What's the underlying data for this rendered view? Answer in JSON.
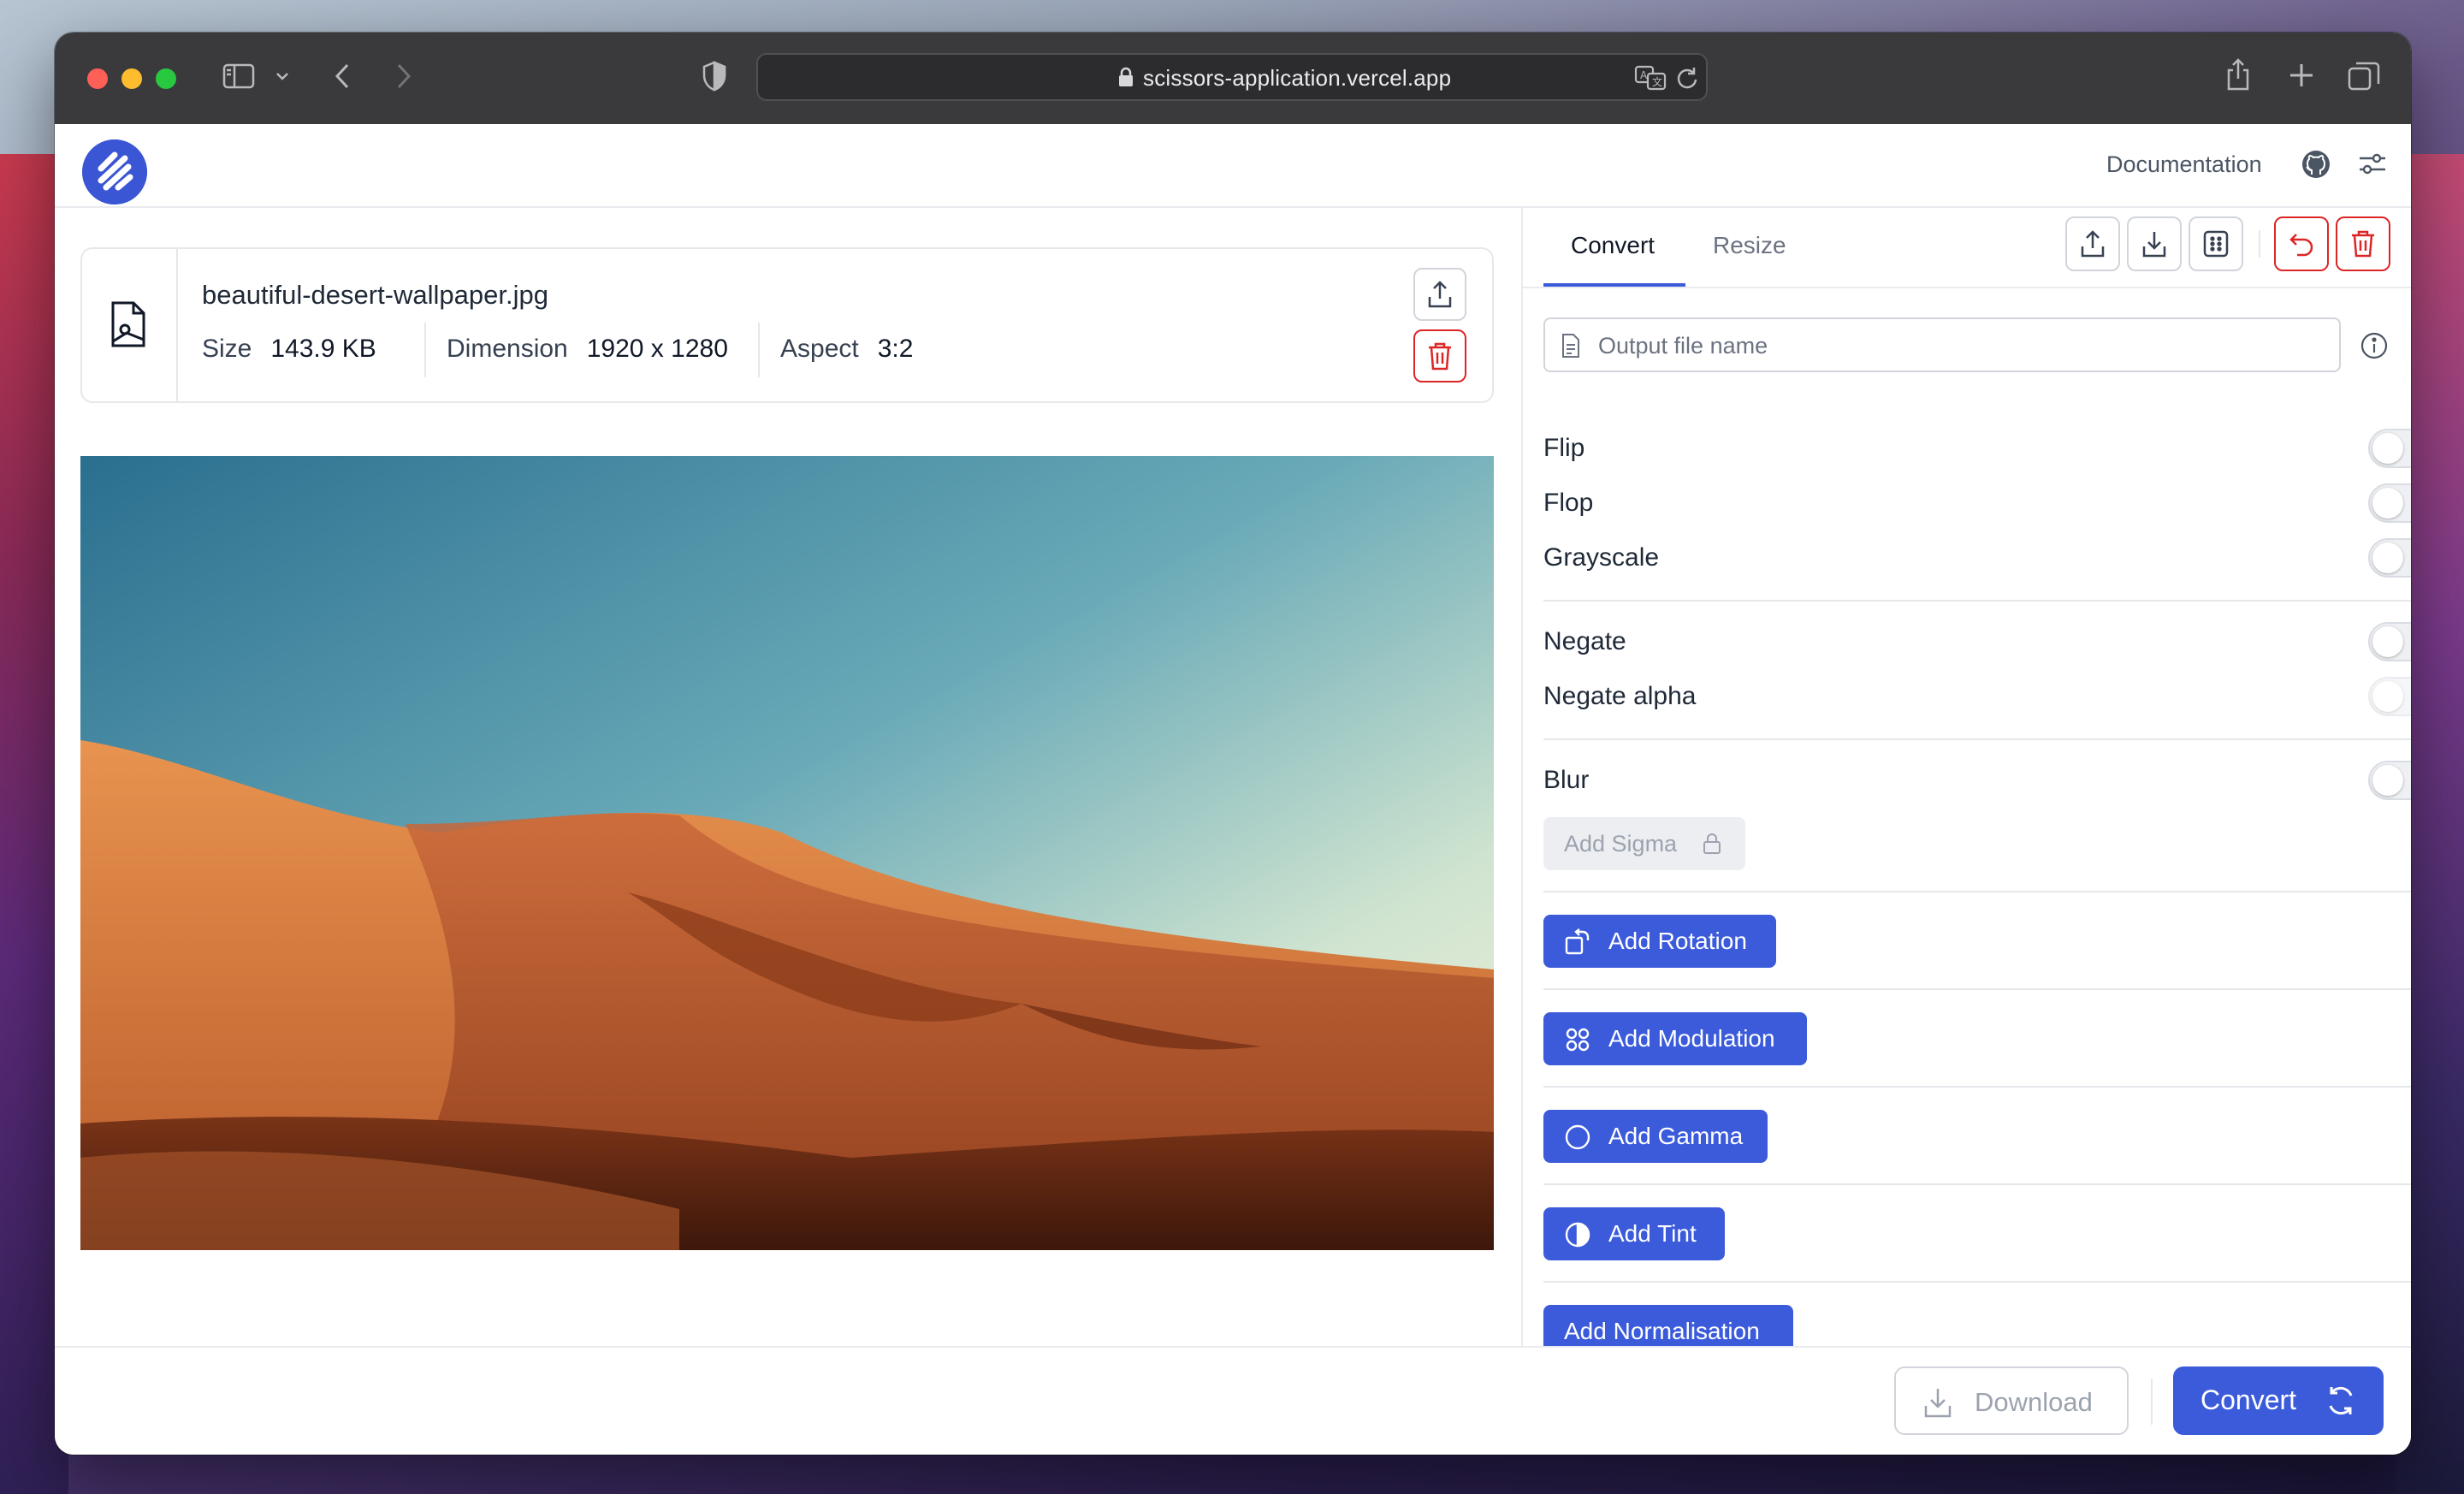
{
  "browser": {
    "url": "scissors-application.vercel.app"
  },
  "header": {
    "documentation_label": "Documentation",
    "icons": [
      "app-logo",
      "github-icon",
      "settings-sliders-icon"
    ]
  },
  "file": {
    "name": "beautiful-desert-wallpaper.jpg",
    "size_label": "Size",
    "size_value": "143.9 KB",
    "dimension_label": "Dimension",
    "dimension_value": "1920 x 1280",
    "aspect_label": "Aspect",
    "aspect_value": "3:2"
  },
  "panel": {
    "tabs": [
      {
        "label": "Convert",
        "active": true
      },
      {
        "label": "Resize",
        "active": false
      }
    ],
    "output_placeholder": "Output file name",
    "options": [
      {
        "label": "Flip",
        "on": false
      },
      {
        "label": "Flop",
        "on": false
      },
      {
        "label": "Grayscale",
        "on": false
      },
      {
        "label": "Negate",
        "on": false
      },
      {
        "label": "Negate alpha",
        "on": false,
        "disabled": true
      },
      {
        "label": "Blur",
        "on": false
      }
    ],
    "add_sigma_label": "Add Sigma",
    "buttons": {
      "rotation": "Add Rotation",
      "modulation": "Add Modulation",
      "gamma": "Add Gamma",
      "tint": "Add Tint",
      "normalisation": "Add Normalisation"
    }
  },
  "footer": {
    "download_label": "Download",
    "convert_label": "Convert"
  },
  "colors": {
    "accent": "#3b5bdb",
    "danger": "#dc2626",
    "titlebar": "#3a3a3c"
  }
}
